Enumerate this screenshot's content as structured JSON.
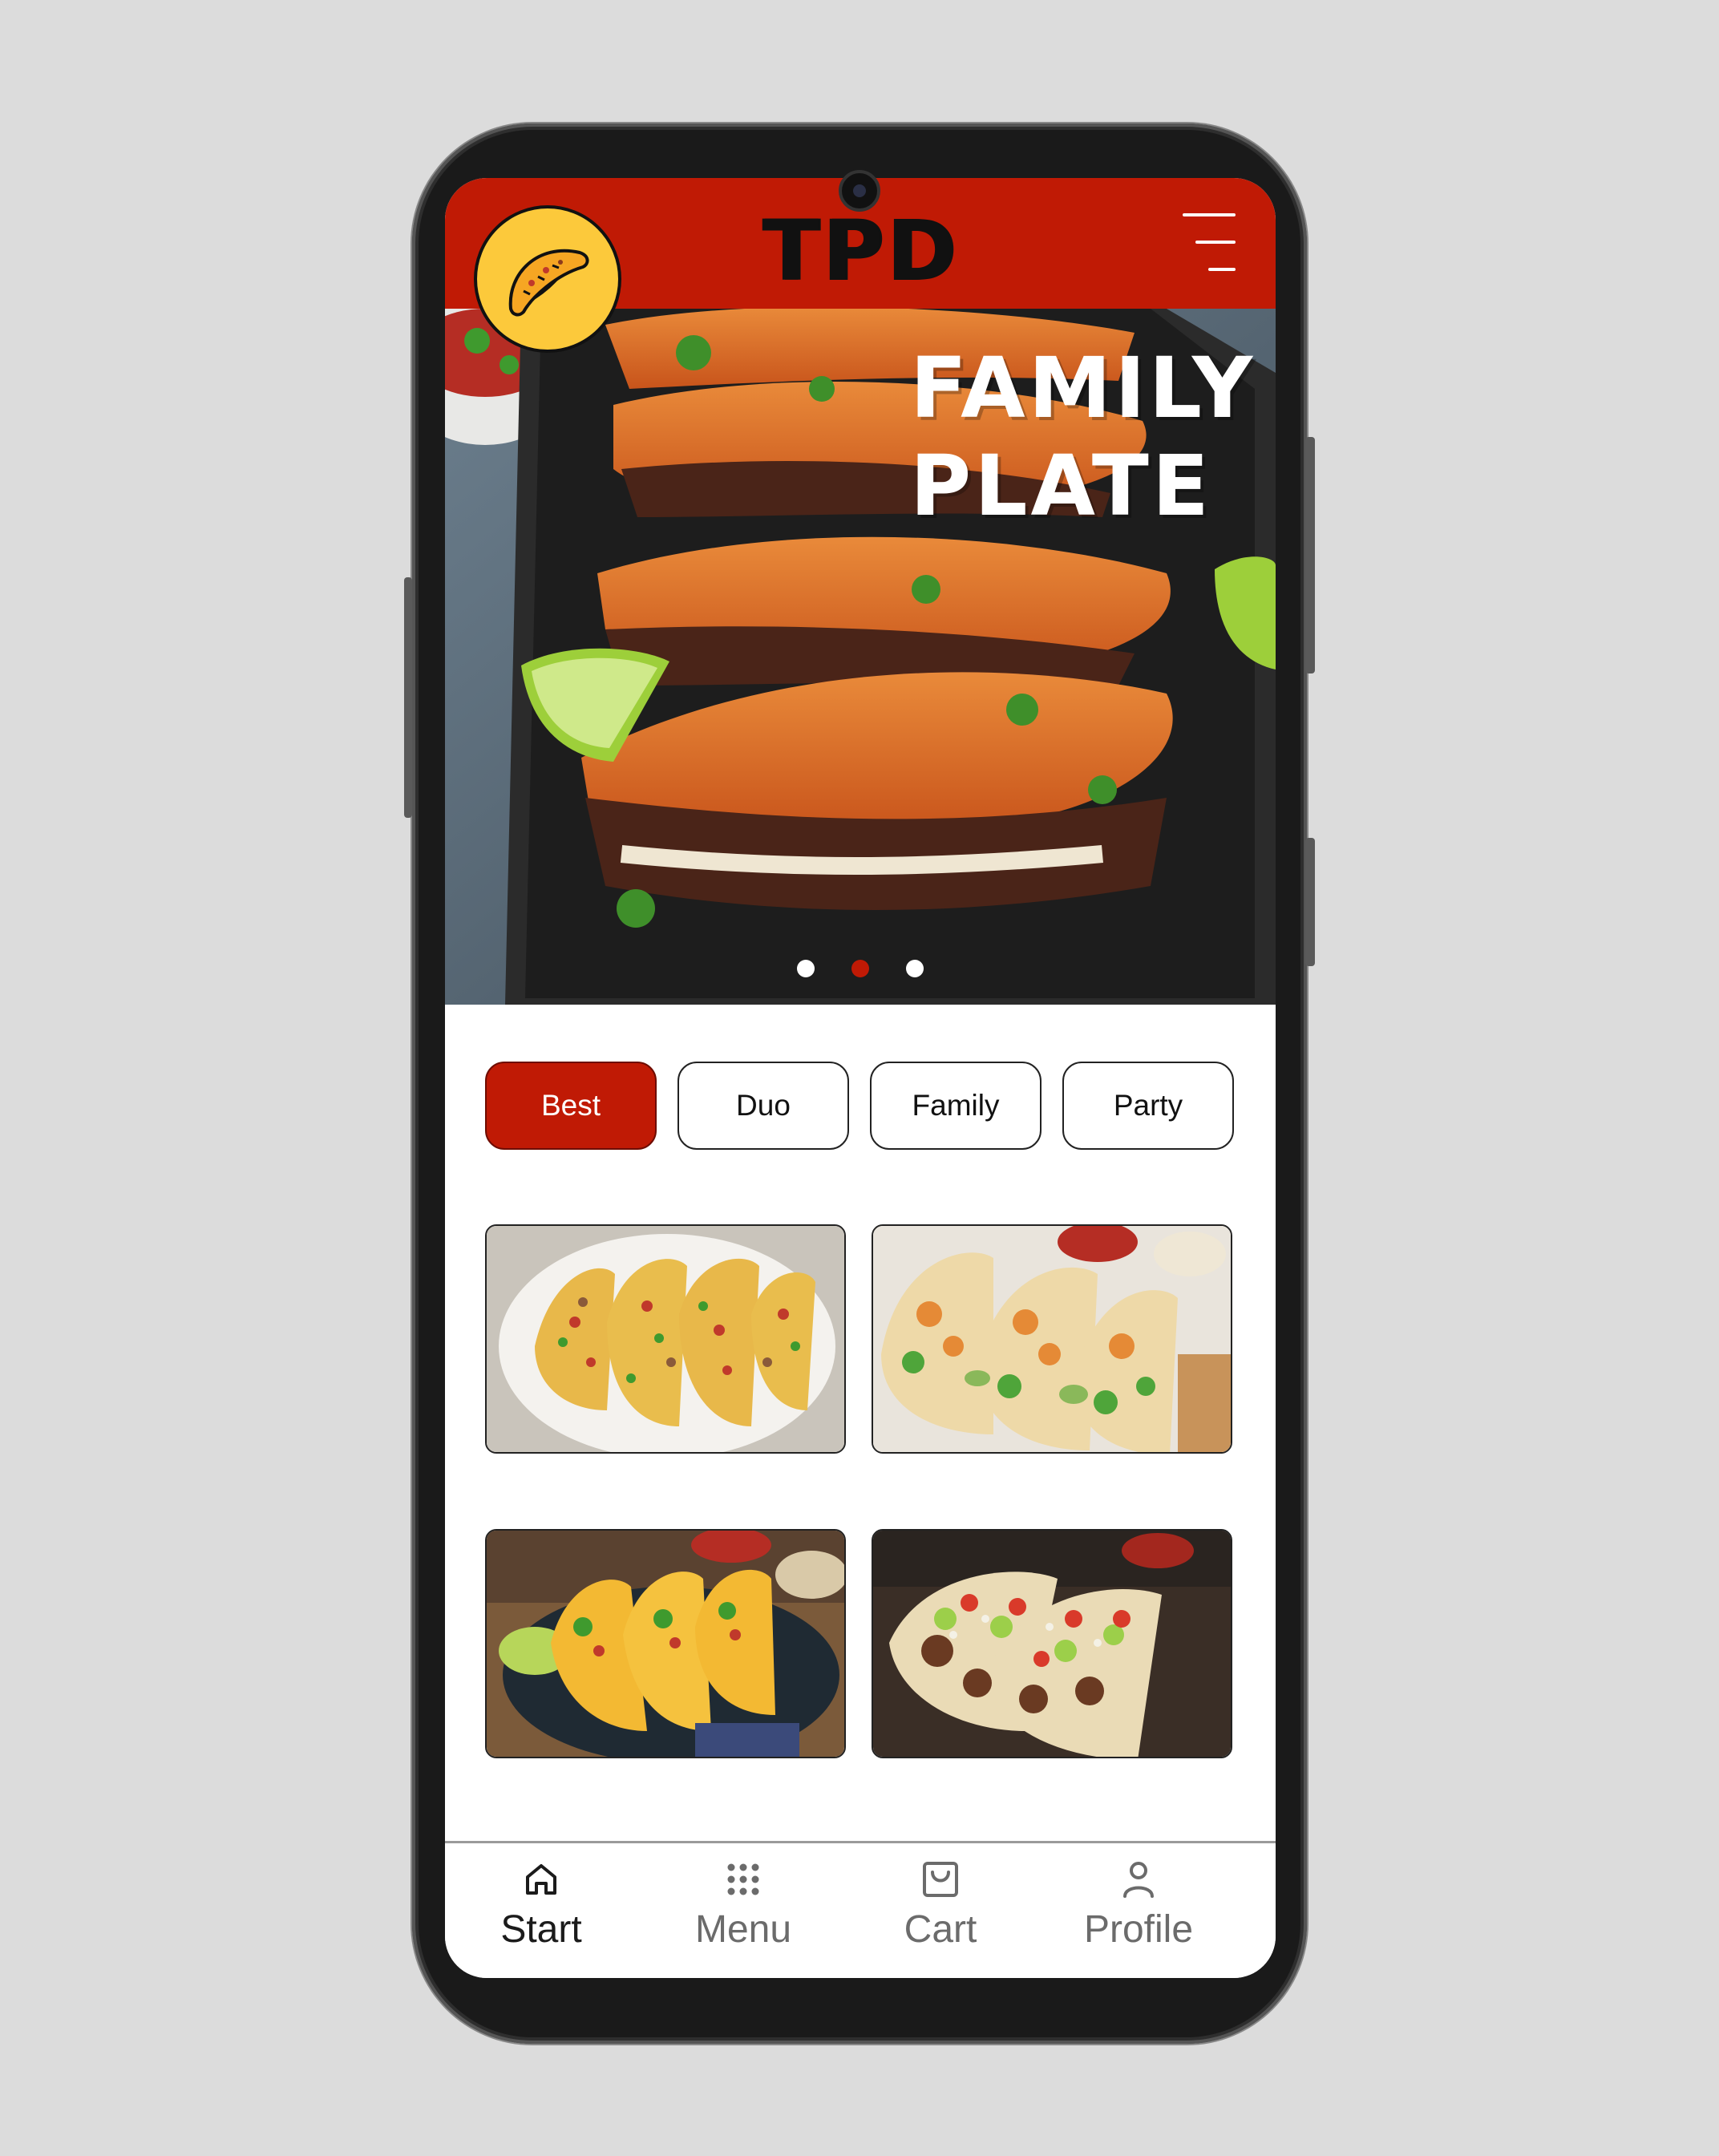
{
  "app": {
    "brand": "TPD",
    "logo_icon": "taco-icon",
    "menu_icon": "hamburger-menu-icon"
  },
  "hero": {
    "title_line1": "FAMILY",
    "title_line2": "PLATE",
    "carousel": {
      "slides": 3,
      "active_index": 2
    }
  },
  "tabs": [
    {
      "label": "Best",
      "active": true
    },
    {
      "label": "Duo",
      "active": false
    },
    {
      "label": "Family",
      "active": false
    },
    {
      "label": "Party",
      "active": false
    }
  ],
  "products": [
    {
      "name": "product-card-1",
      "image": "tacos-plate-photo"
    },
    {
      "name": "product-card-2",
      "image": "chicken-tacos-photo"
    },
    {
      "name": "product-card-3",
      "image": "crispy-tacos-photo"
    },
    {
      "name": "product-card-4",
      "image": "beef-tacos-photo"
    }
  ],
  "bottom_nav": [
    {
      "label": "Start",
      "icon": "home-icon",
      "active": true
    },
    {
      "label": "Menu",
      "icon": "grid-icon",
      "active": false
    },
    {
      "label": "Cart",
      "icon": "bag-icon",
      "active": false
    },
    {
      "label": "Profile",
      "icon": "user-icon",
      "active": false
    }
  ],
  "colors": {
    "accent": "#c01a05",
    "logo_bg": "#fcc93b",
    "background": "#dcdcdc"
  }
}
